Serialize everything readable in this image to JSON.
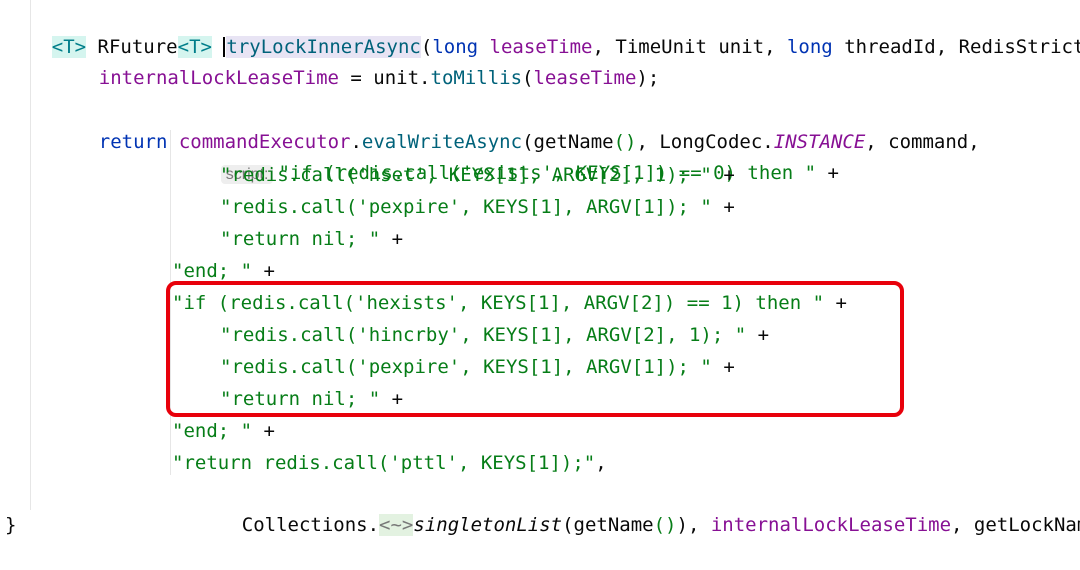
{
  "code": {
    "line1": {
      "generic_open": "<T>",
      "type_name": "RFuture",
      "generic_ret": "<T>",
      "method_name": "tryLockInnerAsync",
      "paren_open": "(",
      "kw_long1": "long",
      "param_leaseTime": "leaseTime",
      "comma1": ", ",
      "type_timeunit": "TimeUnit",
      "param_unit": " unit, ",
      "kw_long2": "long",
      "param_thread": " threadId, ",
      "type_redis": "RedisStrictC"
    },
    "line2": {
      "field": "internalLockLeaseTime",
      "assign": " = unit.",
      "method": "toMillis",
      "paren_open": "(",
      "arg": "leaseTime",
      "paren_close": ");"
    },
    "line3": {
      "kw_return": "return",
      "space": " ",
      "field": "commandExecutor",
      "dot": ".",
      "method": "evalWriteAsync",
      "open": "(getName",
      "parens": "()",
      "middle": ", LongCodec.",
      "constant": "INSTANCE",
      "tail": ", command,"
    },
    "script_hint": "script:",
    "lines": [
      {
        "str": "\"if (redis.call('exists', KEYS[1]) == 0) then \"",
        "op": " +"
      },
      {
        "str": "\"redis.call('hset', KEYS[1], ARGV[2], 1); \"",
        "op": " +"
      },
      {
        "str": "\"redis.call('pexpire', KEYS[1], ARGV[1]); \"",
        "op": " +"
      },
      {
        "str": "\"return nil; \"",
        "op": " +"
      },
      {
        "str": "\"end; \"",
        "op": " +"
      },
      {
        "str": "\"if (redis.call('hexists', KEYS[1], ARGV[2]) == 1) then \"",
        "op": " +"
      },
      {
        "str": "\"redis.call('hincrby', KEYS[1], ARGV[2], 1); \"",
        "op": " +"
      },
      {
        "str": "\"redis.call('pexpire', KEYS[1], ARGV[1]); \"",
        "op": " +"
      },
      {
        "str": "\"return nil; \"",
        "op": " +"
      },
      {
        "str": "\"end; \"",
        "op": " +"
      },
      {
        "str": "\"return redis.call('pttl', KEYS[1]);\"",
        "op": ","
      }
    ],
    "last_line": {
      "class_name": "Collections.",
      "fold": "<~>",
      "method": "singletonList",
      "open": "(getName",
      "parens": "()",
      "close": "), ",
      "field": "internalLockLeaseTime",
      "tail": ", getLockName"
    },
    "closing_brace": "}"
  },
  "highlight_color": "#e8000b"
}
